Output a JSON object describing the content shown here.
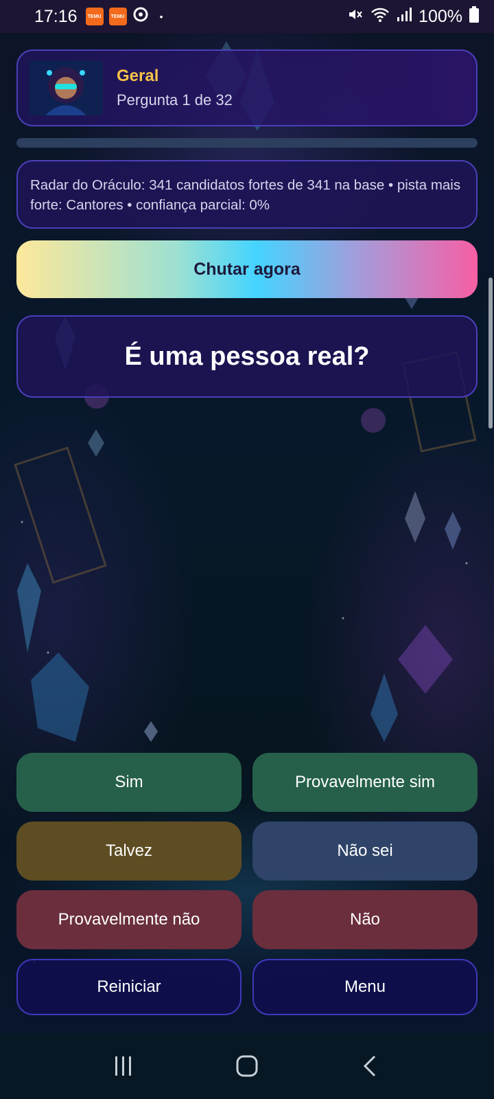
{
  "status_bar": {
    "time": "17:16",
    "notifications": [
      {
        "icon": "temu-icon",
        "label": "TEMU"
      },
      {
        "icon": "temu-icon",
        "label": "TEMU"
      },
      {
        "icon": "sync-icon"
      }
    ],
    "dot": "•",
    "battery": "100%",
    "icons": [
      "mute-icon",
      "wifi-icon",
      "signal-icon",
      "battery-icon"
    ]
  },
  "header": {
    "category": "Geral",
    "question_counter": "Pergunta 1 de 32",
    "avatar_icon": "oracle-avatar"
  },
  "progress": {
    "current": 1,
    "total": 32
  },
  "radar": {
    "text": "Radar do Oráculo: 341 candidatos fortes de 341 na base • pista mais forte: Cantores • confiança parcial: 0%"
  },
  "guess_button": {
    "label": "Chutar agora"
  },
  "question": {
    "text": "É uma pessoa real?"
  },
  "answers": {
    "yes": "Sim",
    "probably_yes": "Provavelmente sim",
    "maybe": "Talvez",
    "dont_know": "Não sei",
    "probably_no": "Provavelmente não",
    "no": "Não"
  },
  "actions": {
    "restart": "Reiniciar",
    "menu": "Menu"
  },
  "colors": {
    "accent_gold": "#f7c24a",
    "card_border": "#4b3fb8",
    "yes_green": "#26604a",
    "maybe_olive": "#5e4c22",
    "unknown_slate": "#2f4468",
    "no_wine": "#6a2e3d"
  },
  "navigation_bar": [
    "recents-icon",
    "home-icon",
    "back-icon"
  ]
}
